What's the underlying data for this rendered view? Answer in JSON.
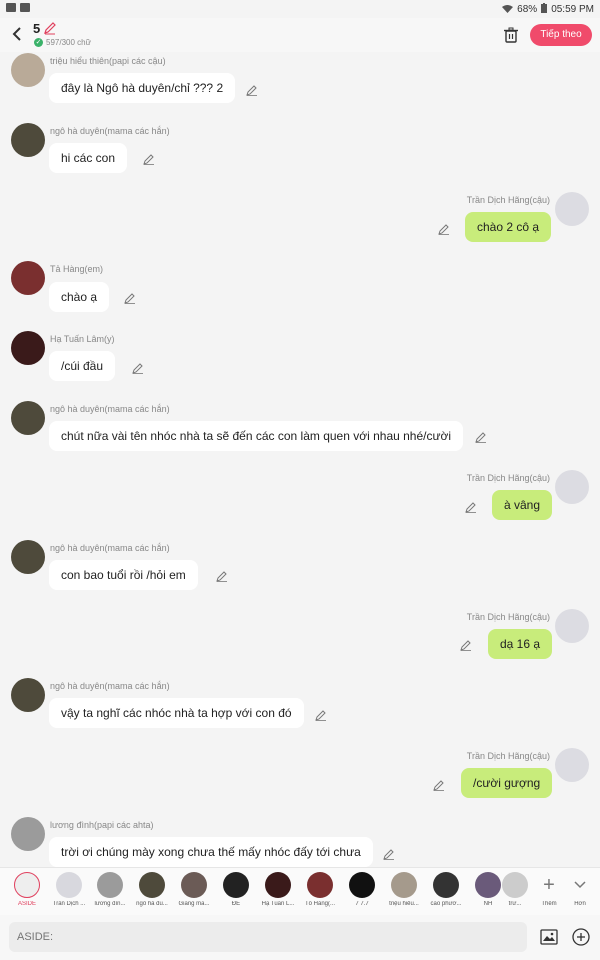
{
  "status_bar": {
    "signal": "68%",
    "time": "05:59 PM"
  },
  "header": {
    "title": "5",
    "word_count": "597/300 chữ",
    "next_label": "Tiếp theo"
  },
  "messages": [
    {
      "side": "left",
      "sender": "triệu hiểu thiên(papi các cậu)",
      "text": "đây là Ngô hà duyên/chỉ ??? 2"
    },
    {
      "side": "left",
      "sender": "ngô hà duyên(mama các hắn)",
      "text": "hi các con"
    },
    {
      "side": "right",
      "sender": "Trần Dịch Hãng(cậu)",
      "text": "chào 2 cô ạ"
    },
    {
      "side": "left",
      "sender": "Tả Hàng(em)",
      "text": "chào ạ"
    },
    {
      "side": "left",
      "sender": "Hạ Tuấn Lâm(y)",
      "text": "/cúi đầu"
    },
    {
      "side": "left",
      "sender": "ngô hà duyên(mama các hắn)",
      "text": "chút nữa vài tên nhóc nhà ta sẽ đến các con làm quen với nhau nhé/cười"
    },
    {
      "side": "right",
      "sender": "Trần Dịch Hãng(cậu)",
      "text": "à vâng"
    },
    {
      "side": "left",
      "sender": "ngô hà duyên(mama các hắn)",
      "text": "con bao tuổi rồi /hỏi em"
    },
    {
      "side": "right",
      "sender": "Trần Dịch Hãng(cậu)",
      "text": "dạ 16 ạ"
    },
    {
      "side": "left",
      "sender": "ngô hà duyên(mama các hắn)",
      "text": "vậy ta nghĩ các nhóc nhà ta hợp với con đó"
    },
    {
      "side": "right",
      "sender": "Trần Dịch Hãng(cậu)",
      "text": "/cười gượng"
    },
    {
      "side": "left",
      "sender": "lương đình(papi các ahta)",
      "text": "trời ơi chúng mày xong chưa thế mấy nhóc đấy tới chưa"
    }
  ],
  "cast": [
    {
      "label": "ASIDE",
      "color": "#e9e9e9"
    },
    {
      "label": "Trần Dịch ...",
      "color": "#d8d8de"
    },
    {
      "label": "lương đìn...",
      "color": "#9b9b9b"
    },
    {
      "label": "ngô hà du...",
      "color": "#4e4a3b"
    },
    {
      "label": "Giang mẫ...",
      "color": "#6b5b56"
    },
    {
      "label": "ĐE",
      "color": "#222222"
    },
    {
      "label": "Hạ Tuấn L...",
      "color": "#3a1a1a"
    },
    {
      "label": "Tô Hàng(...",
      "color": "#7a2f2f"
    },
    {
      "label": "7 7.7",
      "color": "#111111"
    },
    {
      "label": "triệu hiểu...",
      "color": "#a59a8c"
    },
    {
      "label": "cao phươ...",
      "color": "#333333"
    },
    {
      "label": "NH",
      "color": "#6a5a7a"
    },
    {
      "label": "trư...",
      "color": "#cccccc"
    }
  ],
  "more_label": "Thêm",
  "more2_label": "Hơn",
  "input": {
    "placeholder": "ASIDE:"
  }
}
